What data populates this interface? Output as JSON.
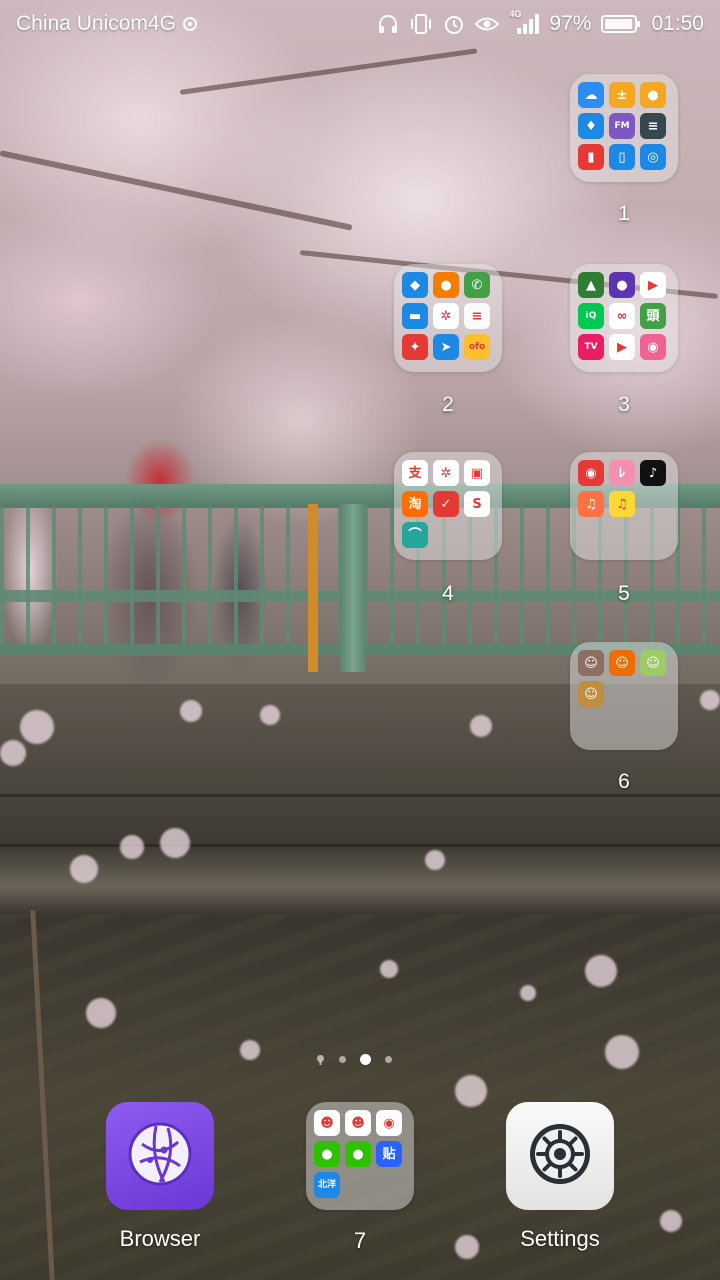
{
  "status_bar": {
    "carrier": "China Unicom4G",
    "network": "4G",
    "battery_percent": "97%",
    "battery_level": 0.97,
    "time": "01:50",
    "icons": [
      "headphones-icon",
      "vibrate-icon",
      "alarm-icon",
      "eye-comfort-icon",
      "signal-icon",
      "battery-icon"
    ]
  },
  "folders": [
    {
      "label": "1",
      "apps": [
        {
          "name": "weather",
          "glyph": "☁",
          "color": "#2d8cf0"
        },
        {
          "name": "calculator",
          "glyph": "±",
          "color": "#f5a623"
        },
        {
          "name": "recorder",
          "glyph": "●",
          "color": "#f5a623"
        },
        {
          "name": "contacts-sync",
          "glyph": "♦",
          "color": "#1e88e5"
        },
        {
          "name": "fm-radio",
          "glyph": "FM",
          "color": "#7e57c2"
        },
        {
          "name": "sound-recorder",
          "glyph": "≡",
          "color": "#37474f"
        },
        {
          "name": "flashlight",
          "glyph": "▮",
          "color": "#e53935"
        },
        {
          "name": "phone-manager",
          "glyph": "▯",
          "color": "#1e88e5"
        },
        {
          "name": "compass",
          "glyph": "◎",
          "color": "#1e88e5"
        }
      ]
    },
    {
      "label": "2",
      "apps": [
        {
          "name": "security",
          "glyph": "◆",
          "color": "#1e88e5"
        },
        {
          "name": "contacts",
          "glyph": "●",
          "color": "#f57c00"
        },
        {
          "name": "phone",
          "glyph": "✆",
          "color": "#43a047"
        },
        {
          "name": "messaging",
          "glyph": "▬",
          "color": "#1e88e5"
        },
        {
          "name": "china-mobile",
          "glyph": "✲",
          "color": "#ffffff"
        },
        {
          "name": "notes",
          "glyph": "≡",
          "color": "#fafafa"
        },
        {
          "name": "ctrip",
          "glyph": "✦",
          "color": "#e53935"
        },
        {
          "name": "maps",
          "glyph": "➤",
          "color": "#1e88e5"
        },
        {
          "name": "ofo",
          "glyph": "ofo",
          "color": "#fbc02d"
        }
      ]
    },
    {
      "label": "3",
      "apps": [
        {
          "name": "gallery",
          "glyph": "▲",
          "color": "#2e7d32"
        },
        {
          "name": "music",
          "glyph": "●",
          "color": "#5e35b1"
        },
        {
          "name": "video-player",
          "glyph": "▶",
          "color": "#ffffff"
        },
        {
          "name": "iqiyi",
          "glyph": "iQ",
          "color": "#00c853"
        },
        {
          "name": "baidu-netdisk",
          "glyph": "∞",
          "color": "#ffffff"
        },
        {
          "name": "news",
          "glyph": "頭",
          "color": "#43a047"
        },
        {
          "name": "pptv",
          "glyph": "TV",
          "color": "#e91e63"
        },
        {
          "name": "tencent-video",
          "glyph": "▶",
          "color": "#ffffff"
        },
        {
          "name": "meitu",
          "glyph": "◉",
          "color": "#f06292"
        }
      ]
    },
    {
      "label": "4",
      "apps": [
        {
          "name": "alipay",
          "glyph": "支",
          "color": "#ffffff"
        },
        {
          "name": "mobile-service",
          "glyph": "✲",
          "color": "#ffffff"
        },
        {
          "name": "bank",
          "glyph": "▣",
          "color": "#ffffff"
        },
        {
          "name": "taobao",
          "glyph": "淘",
          "color": "#ff6d00"
        },
        {
          "name": "jd",
          "glyph": "✓",
          "color": "#e53935"
        },
        {
          "name": "payment",
          "glyph": "S",
          "color": "#ffffff"
        },
        {
          "name": "huawei-wallet",
          "glyph": "⌒",
          "color": "#26a69a"
        }
      ]
    },
    {
      "label": "5",
      "apps": [
        {
          "name": "netease-music",
          "glyph": "◉",
          "color": "#e53935"
        },
        {
          "name": "bilibili",
          "glyph": "ﾚ",
          "color": "#f48fb1"
        },
        {
          "name": "tiktok",
          "glyph": "♪",
          "color": "#111111"
        },
        {
          "name": "music-store",
          "glyph": "♫",
          "color": "#ff7043"
        },
        {
          "name": "qq-music",
          "glyph": "♫",
          "color": "#fdd835"
        }
      ]
    },
    {
      "label": "6",
      "apps": [
        {
          "name": "game-1",
          "glyph": "☺",
          "color": "#8d6e63"
        },
        {
          "name": "game-2",
          "glyph": "☺",
          "color": "#ef6c00"
        },
        {
          "name": "game-3",
          "glyph": "☺",
          "color": "#9ccc65"
        },
        {
          "name": "game-4",
          "glyph": "☺",
          "color": "#bf8f3f"
        }
      ]
    }
  ],
  "page_indicator": {
    "pages": 4,
    "active_index": 2
  },
  "dock": {
    "browser": {
      "label": "Browser",
      "icon": "browser-icon"
    },
    "folder": {
      "label": "7",
      "apps": [
        {
          "name": "qq",
          "glyph": "☻",
          "color": "#ffffff"
        },
        {
          "name": "qq-lite",
          "glyph": "☻",
          "color": "#ffffff"
        },
        {
          "name": "weibo",
          "glyph": "◉",
          "color": "#ffffff"
        },
        {
          "name": "wechat",
          "glyph": "●",
          "color": "#2dc100"
        },
        {
          "name": "wechat-clone",
          "glyph": "●",
          "color": "#2dc100"
        },
        {
          "name": "tieba",
          "glyph": "贴",
          "color": "#2962ff"
        },
        {
          "name": "beiyang",
          "glyph": "北洋",
          "color": "#1e88e5"
        }
      ]
    },
    "settings": {
      "label": "Settings",
      "icon": "gear-icon"
    }
  }
}
